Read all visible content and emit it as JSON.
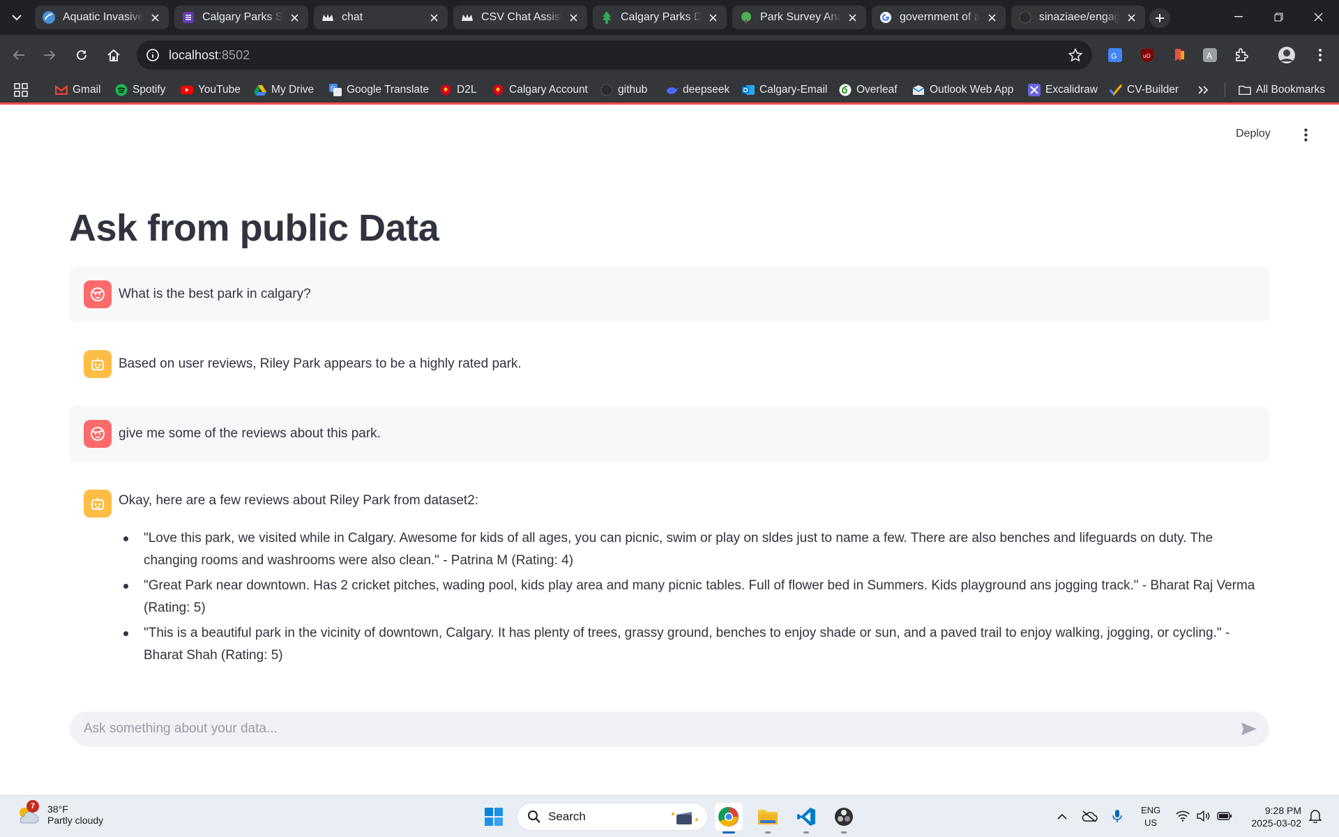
{
  "browser": {
    "tabs": [
      {
        "title": "Aquatic Invasive",
        "icon": "wave-icon",
        "color": "#4a90d9"
      },
      {
        "title": "Calgary Parks Su",
        "icon": "form-icon",
        "color": "#673ab7"
      },
      {
        "title": "chat",
        "icon": "crown-icon",
        "color": "#e8eaed"
      },
      {
        "title": "CSV Chat Assista",
        "icon": "crown-icon",
        "color": "#e8eaed"
      },
      {
        "title": "Calgary Parks Da",
        "icon": "tree-icon",
        "color": "#34a853"
      },
      {
        "title": "Park Survey Anal",
        "icon": "leaf-icon",
        "color": "#4caf50"
      },
      {
        "title": "government of a",
        "icon": "google-icon",
        "color": "#4285f4"
      },
      {
        "title": "sinaziaee/engage",
        "icon": "github-icon",
        "color": "#e8eaed"
      }
    ],
    "url_host": "localhost",
    "url_port": ":8502",
    "bookmarks": [
      {
        "label": "Gmail",
        "icon": "gmail-icon"
      },
      {
        "label": "Spotify",
        "icon": "spotify-icon"
      },
      {
        "label": "YouTube",
        "icon": "youtube-icon"
      },
      {
        "label": "My Drive",
        "icon": "drive-icon"
      },
      {
        "label": "Google Translate",
        "icon": "translate-icon"
      },
      {
        "label": "D2L",
        "icon": "shield-icon"
      },
      {
        "label": "Calgary Account",
        "icon": "shield-icon"
      },
      {
        "label": "github",
        "icon": "github-icon"
      },
      {
        "label": "deepseek",
        "icon": "whale-icon"
      },
      {
        "label": "Calgary-Email",
        "icon": "outlook-icon"
      },
      {
        "label": "Overleaf",
        "icon": "overleaf-icon"
      },
      {
        "label": "Outlook Web App",
        "icon": "mail-icon"
      },
      {
        "label": "Excalidraw",
        "icon": "excalidraw-icon"
      },
      {
        "label": "CV-Builder",
        "icon": "check-icon"
      }
    ],
    "all_bookmarks": "All Bookmarks"
  },
  "app": {
    "deploy_label": "Deploy",
    "title": "Ask from public Data",
    "messages": [
      {
        "role": "user",
        "text": "What is the best park in calgary?"
      },
      {
        "role": "assistant",
        "text": "Based on user reviews, Riley Park appears to be a highly rated park."
      },
      {
        "role": "user",
        "text": "give me some of the reviews about this park."
      },
      {
        "role": "assistant",
        "text": "Okay, here are a few reviews about Riley Park from dataset2:"
      }
    ],
    "reviews": [
      "\"Love this park, we visited while in Calgary. Awesome for kids of all ages, you can picnic, swim or play on sldes just to name a few. There are also benches and lifeguards on duty. The changing rooms and washrooms were also clean.\" - Patrina M (Rating: 4)",
      "\"Great Park near downtown. Has 2 cricket pitches, wading pool, kids play area and many picnic tables. Full of flower bed in Summers. Kids playground ans jogging track.\" - Bharat Raj Verma (Rating: 5)",
      "\"This is a beautiful park in the vicinity of downtown, Calgary. It has plenty of trees, grassy ground, benches to enjoy shade or sun, and a paved trail to enjoy walking, jogging, or cycling.\" - Bharat Shah (Rating: 5)"
    ],
    "input_placeholder": "Ask something about your data..."
  },
  "taskbar": {
    "weather_badge": "7",
    "temperature": "38°F",
    "condition": "Partly cloudy",
    "search_label": "Search",
    "lang_line1": "ENG",
    "lang_line2": "US",
    "time": "9:28 PM",
    "date": "2025-03-02"
  },
  "colors": {
    "accent": "#ff4b4b",
    "user_avatar": "#ff6b6b",
    "bot_avatar": "#ffbd45"
  }
}
